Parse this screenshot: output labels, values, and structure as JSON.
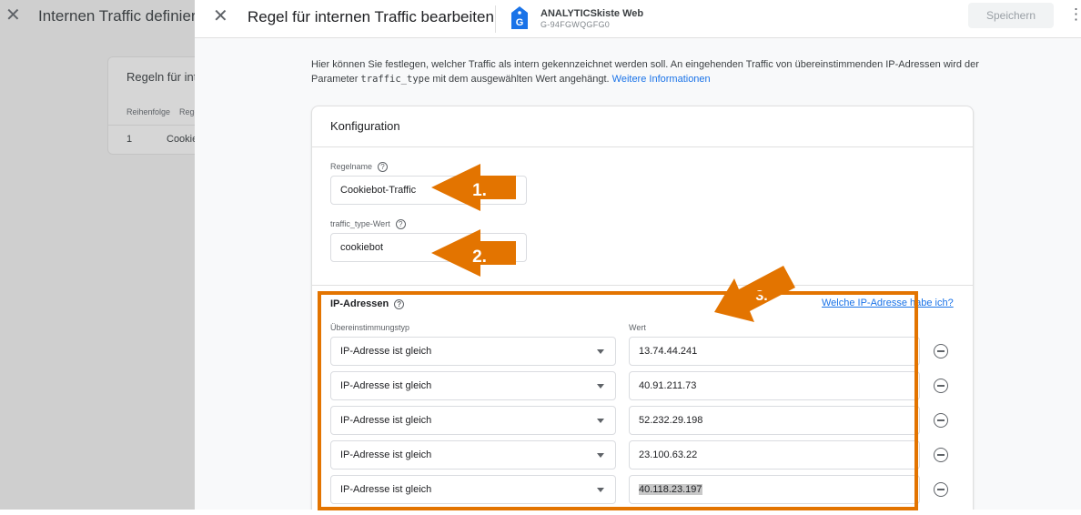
{
  "background": {
    "title": "Internen Traffic definieren",
    "card_title": "Regeln für internen Traffic",
    "columns": [
      "Reihenfolge",
      "Regelname"
    ],
    "row": {
      "order": "1",
      "name": "Cookiebot-Traffic"
    }
  },
  "drawer": {
    "title": "Regel für internen Traffic bearbeiten",
    "property_name": "ANALYTICSkiste Web",
    "property_id": "G-94FGWQGFG0",
    "property_icon_letter": "G",
    "save_label": "Speichern",
    "description_pre": "Hier können Sie festlegen, welcher Traffic als intern gekennzeichnet werden soll. An eingehenden Traffic von übereinstimmenden IP-Adressen wird der Parameter ",
    "description_code": "traffic_type",
    "description_post": " mit dem ausgewählten Wert angehängt. ",
    "learn_more": "Weitere Informationen"
  },
  "config": {
    "title": "Konfiguration",
    "rule_name_label": "Regelname",
    "rule_name_value": "Cookiebot-Traffic",
    "traffic_type_label": "traffic_type-Wert",
    "traffic_type_value": "cookiebot",
    "ip_title": "IP-Adressen",
    "ip_link": "Welche IP-Adresse habe ich?",
    "match_type_label": "Übereinstimmungstyp",
    "value_label": "Wert",
    "rows": [
      {
        "match": "IP-Adresse ist gleich",
        "value": "13.74.44.241"
      },
      {
        "match": "IP-Adresse ist gleich",
        "value": "40.91.211.73"
      },
      {
        "match": "IP-Adresse ist gleich",
        "value": "52.232.29.198"
      },
      {
        "match": "IP-Adresse ist gleich",
        "value": "23.100.63.22"
      },
      {
        "match": "IP-Adresse ist gleich",
        "value": "40.118.23.197"
      }
    ]
  },
  "annotations": {
    "labels": [
      "1.",
      "2.",
      "3."
    ],
    "color": "#e37400"
  },
  "colors": {
    "accent": "#1a73e8",
    "annotation": "#e37400"
  }
}
